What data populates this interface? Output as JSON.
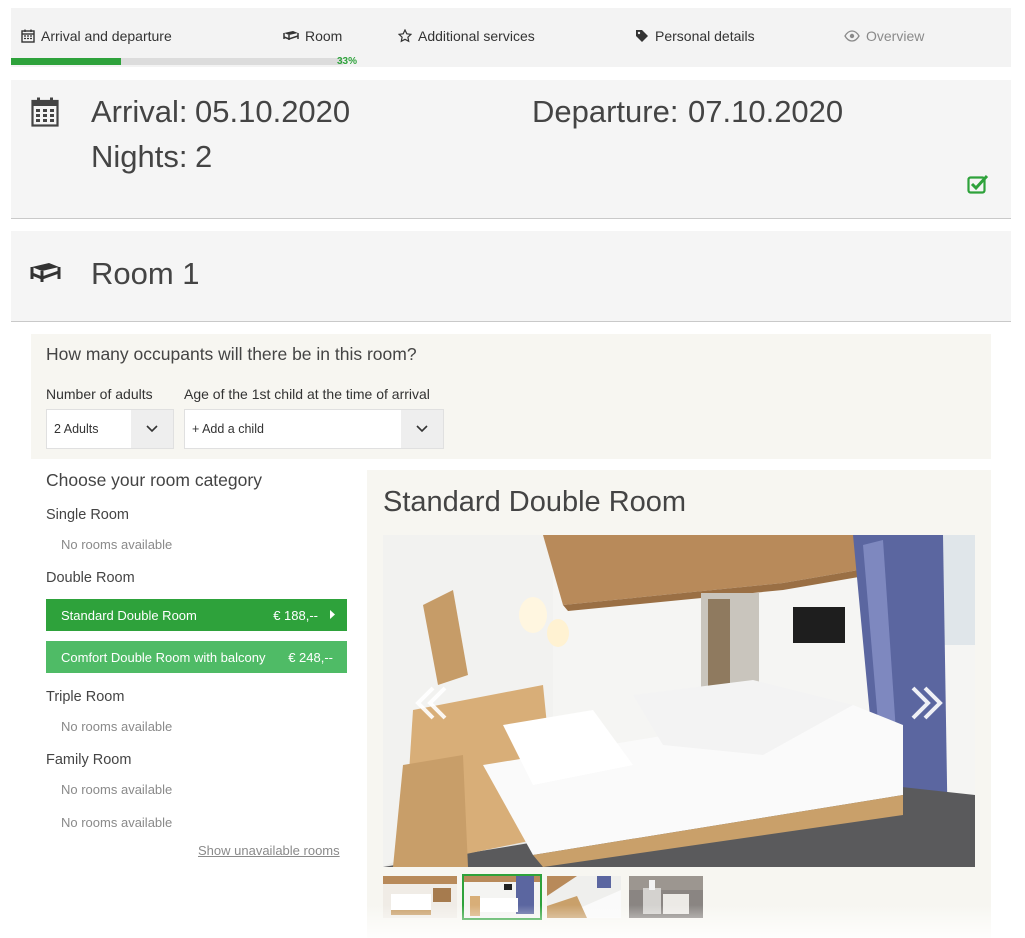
{
  "steps": {
    "items": [
      {
        "label": "Arrival and departure",
        "icon": "calendar-icon"
      },
      {
        "label": "Room",
        "icon": "bed-icon"
      },
      {
        "label": "Additional services",
        "icon": "star-icon"
      },
      {
        "label": "Personal details",
        "icon": "tag-icon"
      },
      {
        "label": "Overview",
        "icon": "eye-icon"
      }
    ],
    "progress_label": "33%",
    "progress": 0.33
  },
  "arrival": {
    "arrival_label": "Arrival:",
    "arrival_value": "05.10.2020",
    "departure_label": "Departure:",
    "departure_value": "07.10.2020",
    "nights_label": "Nights:",
    "nights_value": "2"
  },
  "room": {
    "title": "Room 1"
  },
  "occupants": {
    "question": "How many occupants will there be in this room?",
    "adults_label": "Number of adults",
    "adults_value": "2 Adults",
    "child_label": "Age of the 1st child at the time of arrival",
    "child_value": "+ Add a child"
  },
  "categories": {
    "heading": "Choose your room category",
    "single": {
      "name": "Single Room",
      "status": "No rooms available"
    },
    "double": {
      "name": "Double Room",
      "options": [
        {
          "name": "Standard Double Room",
          "price": "€ 188,--"
        },
        {
          "name": "Comfort Double Room with balcony",
          "price": "€ 248,--"
        }
      ]
    },
    "triple": {
      "name": "Triple Room",
      "status": "No rooms available"
    },
    "family": {
      "name": "Family Room",
      "status_1": "No rooms available",
      "status_2": "No rooms available"
    },
    "show_unavailable": "Show unavailable rooms"
  },
  "detail": {
    "title": "Standard Double Room",
    "thumbnails_count": 4,
    "selected_thumbnail": 2
  },
  "colors": {
    "accent": "#2ea23b",
    "accent_light": "#4fbb66"
  }
}
